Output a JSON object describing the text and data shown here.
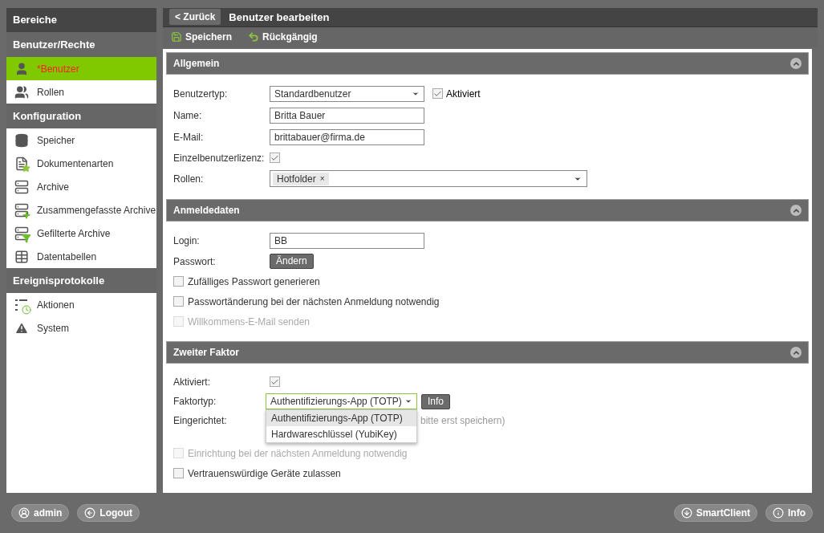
{
  "sidebar": {
    "title": "Bereiche",
    "groups": [
      {
        "title": "Benutzer/Rechte",
        "items": [
          {
            "label": "*Benutzer",
            "selected": true
          },
          {
            "label": "Rollen",
            "selected": false
          }
        ]
      },
      {
        "title": "Konfiguration",
        "items": [
          {
            "label": "Speicher",
            "selected": false
          },
          {
            "label": "Dokumentenarten",
            "selected": false
          },
          {
            "label": "Archive",
            "selected": false
          },
          {
            "label": "Zusammengefasste Archive",
            "selected": false
          },
          {
            "label": "Gefilterte Archive",
            "selected": false
          },
          {
            "label": "Datentabellen",
            "selected": false
          }
        ]
      },
      {
        "title": "Ereignisprotokolle",
        "items": [
          {
            "label": "Aktionen",
            "selected": false
          },
          {
            "label": "System",
            "selected": false
          }
        ]
      }
    ]
  },
  "header": {
    "back": "< Zurück",
    "title": "Benutzer bearbeiten"
  },
  "toolbar": [
    "Speichern",
    "Rückgängig"
  ],
  "sections": [
    {
      "title": "Allgemein",
      "rows": [
        {
          "kind": "select",
          "label": "Benutzertyp:",
          "value": "Standardbenutzer",
          "extra": {
            "label": "Aktiviert",
            "checked": true
          }
        },
        {
          "kind": "text",
          "label": "Name:",
          "value": "Britta Bauer"
        },
        {
          "kind": "text",
          "label": "E-Mail:",
          "value": "brittabauer@firma.de"
        },
        {
          "kind": "check",
          "label": "Einzelbenutzerlizenz:",
          "checked": true
        },
        {
          "kind": "tags",
          "label": "Rollen:",
          "tags": [
            {
              "label": "Hotfolder",
              "remove": "×"
            }
          ]
        }
      ]
    },
    {
      "title": "Anmeldedaten",
      "rows": [
        {
          "kind": "text",
          "label": "Login:",
          "value": "BB"
        },
        {
          "kind": "button",
          "label": "Passwort:",
          "button": "Ändern"
        },
        {
          "kind": "option",
          "label": "Zufälliges Passwort generieren",
          "checked": false,
          "disabled": false
        },
        {
          "kind": "option",
          "label": "Passwortänderung bei der nächsten Anmeldung notwendig",
          "checked": false,
          "disabled": false
        },
        {
          "kind": "option",
          "label": "Willkommens-E-Mail senden",
          "checked": false,
          "disabled": true
        }
      ]
    },
    {
      "title": "Zweiter Faktor",
      "rows": [
        {
          "kind": "check",
          "label": "Aktiviert:",
          "checked": true
        },
        {
          "kind": "factor",
          "label": "Faktortyp:",
          "value": "Authentifizierungs-App (TOTP)",
          "button": "Info",
          "options": [
            {
              "label": "Authentifizierungs-App (TOTP)",
              "selected": true
            },
            {
              "label": "Hardwareschlüssel (YubiKey)",
              "selected": false
            }
          ]
        },
        {
          "kind": "note",
          "label": "Eingerichtet:",
          "value": "bitte erst speichern)"
        },
        {
          "kind": "option",
          "label": "Einrichtung bei der nächsten Anmeldung notwendig",
          "checked": false,
          "disabled": true
        },
        {
          "kind": "option",
          "label": "Vertrauenswürdige Geräte zulassen",
          "checked": false,
          "disabled": false
        }
      ]
    }
  ],
  "footer": {
    "left": [
      "admin",
      "Logout"
    ],
    "right": [
      "SmartClient",
      "Info"
    ]
  }
}
